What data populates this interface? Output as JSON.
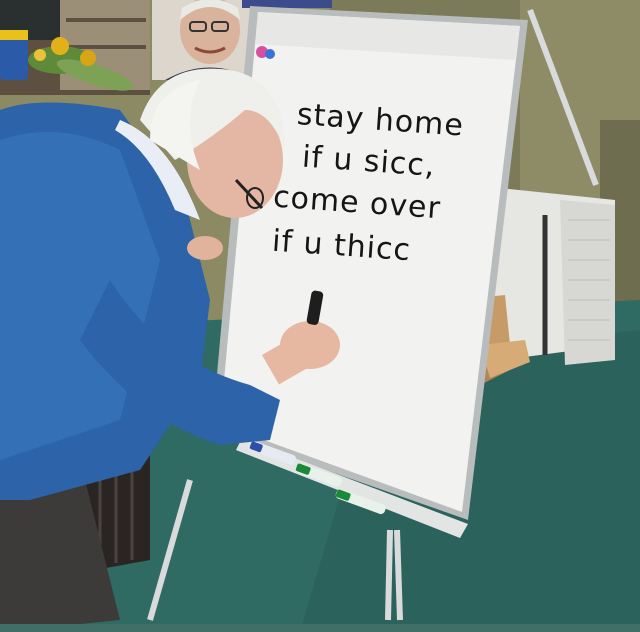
{
  "whiteboard": {
    "lines": [
      "stay home",
      "if u sicc,",
      "come over",
      "if u thicc"
    ]
  }
}
